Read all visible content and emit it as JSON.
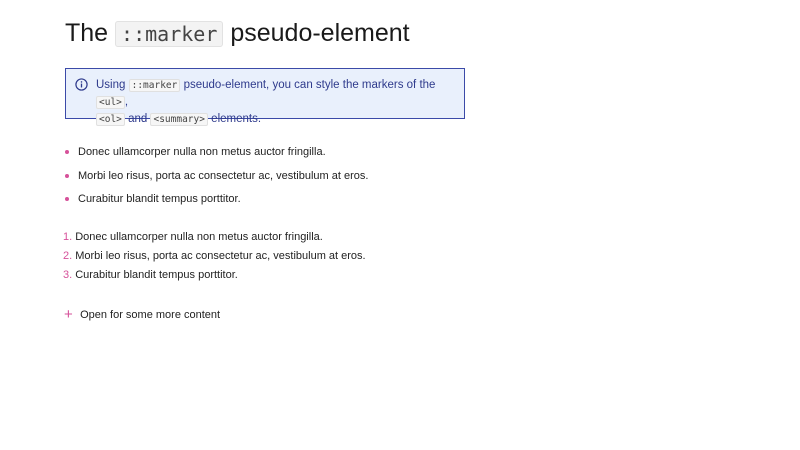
{
  "heading": {
    "prefix": "The",
    "code": "::marker",
    "suffix": "pseudo-element"
  },
  "note": {
    "icon": "info-icon",
    "text_1": "Using",
    "code_1": "::marker",
    "text_2": "pseudo-element, you can style the markers of the",
    "code_2": "<ul>",
    "text_3": ",",
    "code_3": "<ol>",
    "text_4": "and",
    "code_4": "<summary>",
    "text_5": "elements."
  },
  "unordered_list": [
    "Donec ullamcorper nulla non metus auctor fringilla.",
    "Morbi leo risus, porta ac consectetur ac, vestibulum at eros.",
    "Curabitur blandit tempus porttitor."
  ],
  "ordered_list": {
    "numbers": [
      "1.",
      "2.",
      "3."
    ],
    "items": [
      "Donec ullamcorper nulla non metus auctor fringilla.",
      "Morbi leo risus, porta ac consectetur ac, vestibulum at eros.",
      "Curabitur blandit tempus porttitor."
    ]
  },
  "details": {
    "marker": "+",
    "summary": "Open for some more content"
  },
  "colors": {
    "accent": "#d6519a",
    "note_background": "#e9f0fc",
    "note_border": "#3b4aa8",
    "note_text": "#2e3a8c"
  }
}
